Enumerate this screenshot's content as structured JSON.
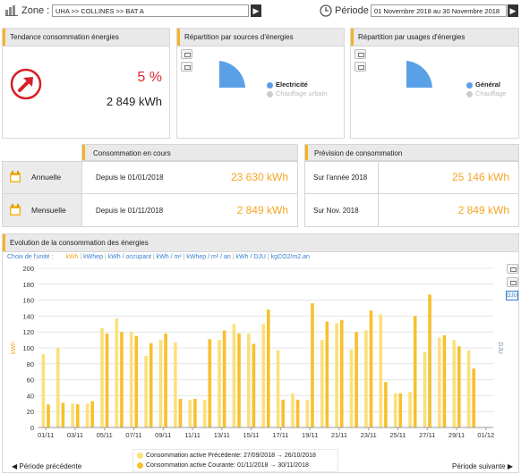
{
  "topbar": {
    "zone_label": "Zone :",
    "zone_value": "UHA >> COLLINES >> BAT A",
    "period_label": "Période :",
    "period_value": "01 Novembre 2018 au 30 Novembre 2018"
  },
  "trend": {
    "title": "Tendance consommation énergies",
    "percent": "5 %",
    "kwh": "2 849 kWh"
  },
  "sources": {
    "title": "Répartition par sources d'énergies",
    "legend": [
      {
        "label": "Electricité",
        "color": "#5aa0e6",
        "active": true
      },
      {
        "label": "Chauffage urbain",
        "color": "#cccccc",
        "active": false
      }
    ]
  },
  "usages": {
    "title": "Répartition par usages d'énergies",
    "legend": [
      {
        "label": "Général",
        "color": "#5aa0e6",
        "active": true
      },
      {
        "label": "Chauffage",
        "color": "#cccccc",
        "active": false
      }
    ]
  },
  "current": {
    "title": "Consommation en cours",
    "rows": [
      {
        "label": "Annuelle",
        "since": "Depuis le 01/01/2018",
        "value": "23 630 kWh"
      },
      {
        "label": "Mensuelle",
        "since": "Depuis le 01/11/2018",
        "value": "2 849 kWh"
      }
    ]
  },
  "forecast": {
    "title": "Prévision de consommation",
    "rows": [
      {
        "label": "Sur l'année 2018",
        "value": "25 146 kWh"
      },
      {
        "label": "Sur Nov. 2018",
        "value": "2 849 kWh"
      }
    ]
  },
  "evolution": {
    "title": "Evolution de la consommation des énergies",
    "unit_prompt": "Choix de l'unité :",
    "units": [
      "kWh",
      "kWhep",
      "kWh / occupant",
      "kWh / m²",
      "kWhep / m² / an",
      "kWh / DJU",
      "kgCO2/m2.an"
    ],
    "selected_unit": "kWh",
    "dju_button": "DJU",
    "prev": "Période précédente",
    "next": "Période suivante"
  },
  "chart_data": {
    "type": "bar",
    "ylabel": "kWh",
    "y2label": "DJU",
    "ylim": [
      0,
      200
    ],
    "yticks": [
      0,
      20,
      40,
      60,
      80,
      100,
      120,
      140,
      160,
      180,
      200
    ],
    "xticks": [
      "01/11",
      "03/11",
      "05/11",
      "07/11",
      "09/11",
      "11/11",
      "13/11",
      "15/11",
      "17/11",
      "19/11",
      "21/11",
      "23/11",
      "25/11",
      "27/11",
      "29/11",
      "01/12"
    ],
    "categories": [
      "01/11",
      "02/11",
      "03/11",
      "04/11",
      "05/11",
      "06/11",
      "07/11",
      "08/11",
      "09/11",
      "10/11",
      "11/11",
      "12/11",
      "13/11",
      "14/11",
      "15/11",
      "16/11",
      "17/11",
      "18/11",
      "19/11",
      "20/11",
      "21/11",
      "22/11",
      "23/11",
      "24/11",
      "25/11",
      "26/11",
      "27/11",
      "28/11",
      "29/11",
      "30/11"
    ],
    "series": [
      {
        "name": "Consommation active Précédente: 27/09/2018 → 26/10/2018",
        "color": "#fbe07a",
        "values": [
          92,
          100,
          30,
          30,
          125,
          137,
          120,
          90,
          110,
          107,
          35,
          35,
          110,
          130,
          118,
          130,
          97,
          43,
          35,
          110,
          131,
          98,
          122,
          142,
          43,
          45,
          95,
          113,
          110,
          97
        ]
      },
      {
        "name": "Consommation active Courante: 01/11/2018 → 30/11/2018",
        "color": "#f7c02c",
        "values": [
          29,
          31,
          29,
          33,
          118,
          120,
          115,
          106,
          118,
          36,
          36,
          111,
          122,
          118,
          105,
          148,
          35,
          35,
          156,
          133,
          135,
          120,
          147,
          57,
          43,
          140,
          167,
          116,
          102,
          74
        ]
      }
    ]
  }
}
